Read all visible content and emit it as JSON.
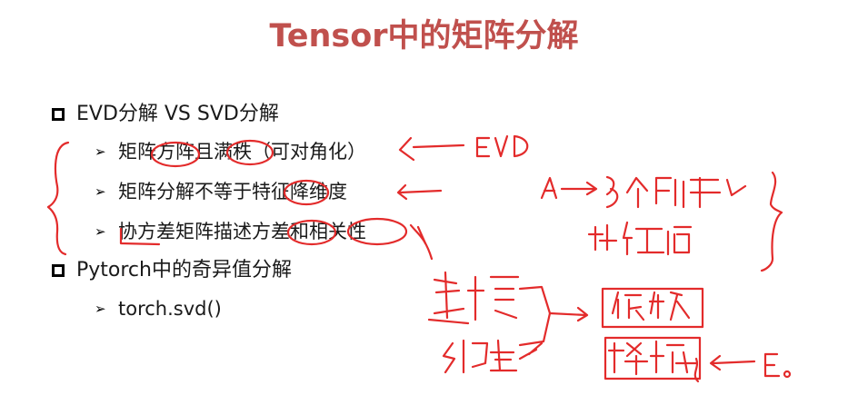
{
  "slide": {
    "title": "Tensor中的矩阵分解",
    "bullets": [
      {
        "level": 1,
        "text": "EVD分解 VS SVD分解"
      },
      {
        "level": 2,
        "text": "矩阵方阵且满秩（可对角化）"
      },
      {
        "level": 2,
        "text": "矩阵分解不等于特征降维度"
      },
      {
        "level": 2,
        "text": "协方差矩阵描述方差和相关性"
      },
      {
        "level": 1,
        "text": "Pytorch中的奇异值分解"
      },
      {
        "level": 2,
        "text": " torch.svd()"
      }
    ],
    "title_color": "#c0504d",
    "ink_color": "#e32b2b"
  },
  "annotations": {
    "evd_note": "EVD",
    "a_note": "A",
    "matrix_note": "多个矩阵",
    "eigen_note": "特征值",
    "left_note_1": "建模",
    "left_note_2": "约束",
    "box1_note": "低秩",
    "box2_note": "稀疏",
    "e_note": "E"
  }
}
